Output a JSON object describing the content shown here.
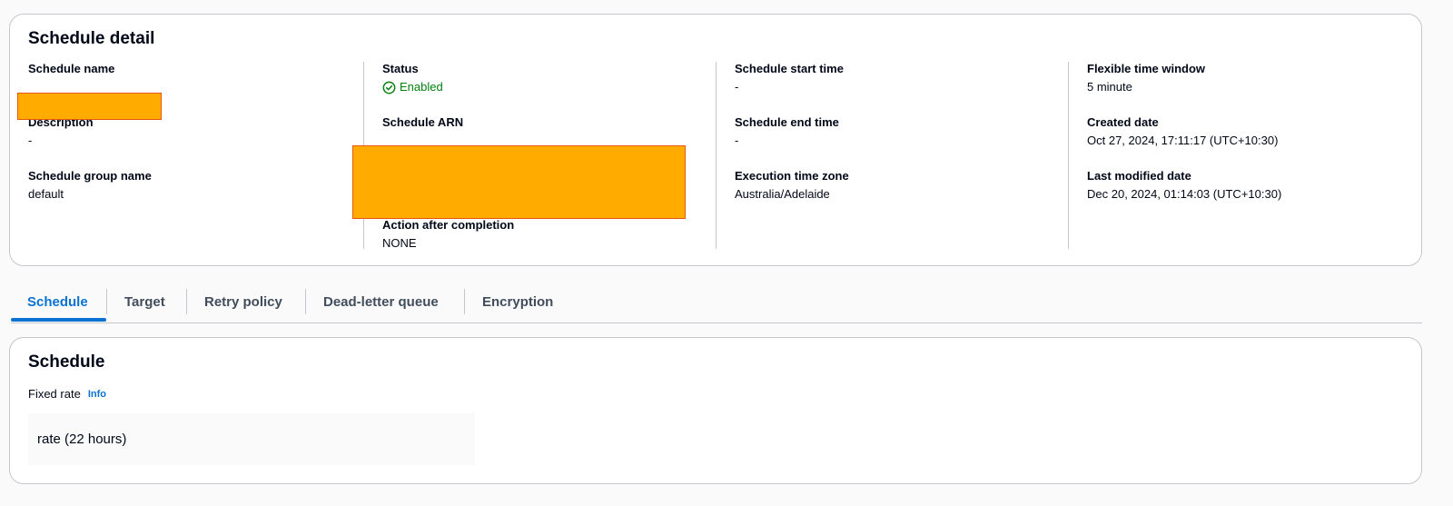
{
  "detail": {
    "title": "Schedule detail",
    "schedule_name_label": "Schedule name",
    "description_label": "Description",
    "description_value": "-",
    "schedule_group_label": "Schedule group name",
    "schedule_group_value": "default",
    "status_label": "Status",
    "status_value": "Enabled",
    "schedule_arn_label": "Schedule ARN",
    "action_after_label": "Action after completion",
    "action_after_value": "NONE",
    "start_time_label": "Schedule start time",
    "start_time_value": "-",
    "end_time_label": "Schedule end time",
    "end_time_value": "-",
    "timezone_label": "Execution time zone",
    "timezone_value": "Australia/Adelaide",
    "flex_window_label": "Flexible time window",
    "flex_window_value": "5 minute",
    "created_label": "Created date",
    "created_value": "Oct 27, 2024, 17:11:17 (UTC+10:30)",
    "modified_label": "Last modified date",
    "modified_value": "Dec 20, 2024, 01:14:03 (UTC+10:30)"
  },
  "tabs": [
    {
      "label": "Schedule",
      "active": true
    },
    {
      "label": "Target",
      "active": false
    },
    {
      "label": "Retry policy",
      "active": false
    },
    {
      "label": "Dead-letter queue",
      "active": false
    },
    {
      "label": "Encryption",
      "active": false
    }
  ],
  "schedule": {
    "title": "Schedule",
    "rate_label": "Fixed rate",
    "info_label": "Info",
    "rate_value": "rate (22 hours)"
  },
  "icons": {
    "status": "check-circle-icon"
  },
  "colors": {
    "accent": "#0972d3",
    "success": "#037f0c",
    "redaction": "#ffab00"
  }
}
